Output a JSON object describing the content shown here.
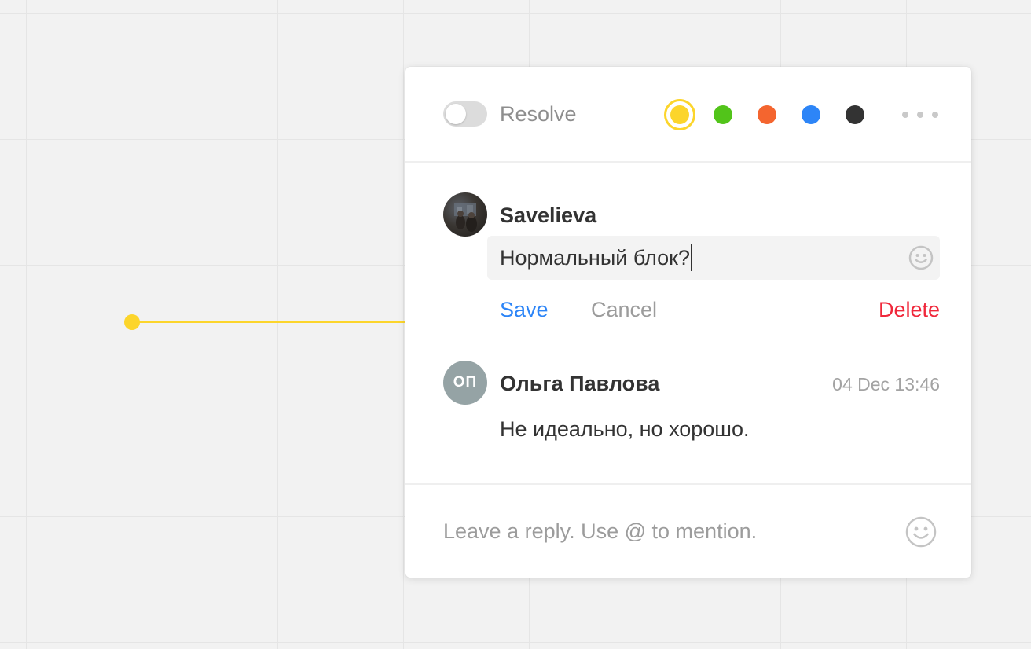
{
  "colors": {
    "accent_yellow": "#fcd52b",
    "swatches": [
      "#fcd52b",
      "#52c41a",
      "#f4652f",
      "#2d85f7",
      "#333333"
    ],
    "save": "#2d85f7",
    "delete": "#f0283b"
  },
  "header": {
    "resolve_label": "Resolve",
    "resolve_enabled": false,
    "selected_color": "yellow"
  },
  "editing_comment": {
    "author": "Savelieva",
    "text": "Нормальный блок?",
    "save_label": "Save",
    "cancel_label": "Cancel",
    "delete_label": "Delete"
  },
  "comment": {
    "author": "Ольга Павлова",
    "initials": "ОП",
    "timestamp": "04 Dec 13:46",
    "text": "Не идеально, но хорошо."
  },
  "reply": {
    "placeholder": "Leave a reply. Use @ to mention."
  },
  "icons": {
    "more": "more-dots-icon",
    "emoji": "smiley-icon"
  }
}
